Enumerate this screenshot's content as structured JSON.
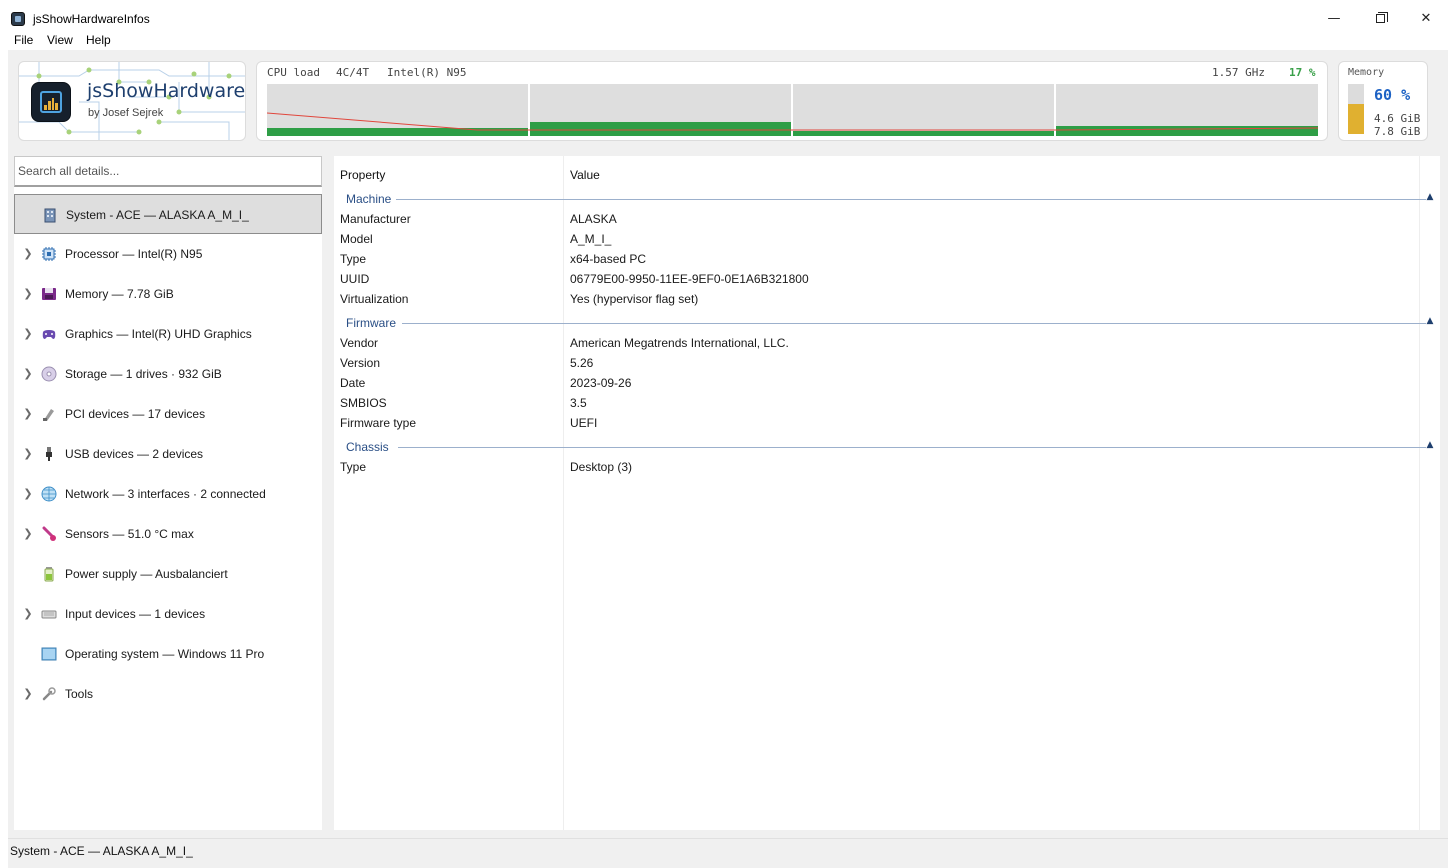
{
  "window": {
    "title": "jsShowHardwareInfos"
  },
  "menu": [
    "File",
    "View",
    "Help"
  ],
  "logo": {
    "title": "jsShowHardware",
    "subtitle": "by Josef Sejrek"
  },
  "cpu": {
    "label": "CPU load",
    "cores_label": "4C/4T",
    "model": "Intel(R) N95",
    "freq": "1.57 GHz",
    "load": "17 %",
    "core_loads": [
      0.15,
      0.27,
      0.1,
      0.2
    ]
  },
  "memory": {
    "label": "Memory",
    "percent": "60 %",
    "used": "4.6 GiB",
    "total": "7.8 GiB",
    "fraction": 0.6
  },
  "search": {
    "placeholder": "Search all details..."
  },
  "nav": [
    {
      "label": "System - ACE  —  ALASKA A_M_I_",
      "icon": "system-icon",
      "expandable": false,
      "selected": true
    },
    {
      "label": "Processor  —  Intel(R) N95",
      "icon": "processor-icon",
      "expandable": true
    },
    {
      "label": "Memory  —  7.78 GiB",
      "icon": "memory-icon",
      "expandable": true
    },
    {
      "label": "Graphics  —  Intel(R) UHD Graphics",
      "icon": "graphics-icon",
      "expandable": true
    },
    {
      "label": "Storage  —  1 drives · 932 GiB",
      "icon": "storage-icon",
      "expandable": true
    },
    {
      "label": "PCI devices  —  17 devices",
      "icon": "pci-icon",
      "expandable": true
    },
    {
      "label": "USB devices  —  2 devices",
      "icon": "usb-icon",
      "expandable": true
    },
    {
      "label": "Network  —  3 interfaces · 2 connected",
      "icon": "network-icon",
      "expandable": true
    },
    {
      "label": "Sensors  —  51.0 °C max",
      "icon": "sensors-icon",
      "expandable": true
    },
    {
      "label": "Power supply  —  Ausbalanciert",
      "icon": "power-supply-icon",
      "expandable": false
    },
    {
      "label": "Input devices  —  1 devices",
      "icon": "input-devices-icon",
      "expandable": true
    },
    {
      "label": "Operating system  —  Windows 11 Pro",
      "icon": "operating-system-icon",
      "expandable": false
    },
    {
      "label": "Tools",
      "icon": "tools-icon",
      "expandable": true
    }
  ],
  "table": {
    "col_property": "Property",
    "col_value": "Value",
    "groups": [
      {
        "name": "Machine",
        "rows": [
          [
            "Manufacturer",
            "ALASKA"
          ],
          [
            "Model",
            "A_M_I_"
          ],
          [
            "Type",
            "x64-based PC"
          ],
          [
            "UUID",
            "06779E00-9950-11EE-9EF0-0E1A6B321800"
          ],
          [
            "Virtualization",
            "Yes (hypervisor flag set)"
          ]
        ]
      },
      {
        "name": "Firmware",
        "rows": [
          [
            "Vendor",
            "American Megatrends International, LLC."
          ],
          [
            "Version",
            "5.26"
          ],
          [
            "Date",
            "2023-09-26"
          ],
          [
            "SMBIOS",
            "3.5"
          ],
          [
            "Firmware type",
            "UEFI"
          ]
        ]
      },
      {
        "name": "Chassis",
        "rows": [
          [
            "Type",
            "Desktop (3)"
          ]
        ]
      }
    ]
  },
  "status": {
    "text": "System - ACE  —  ALASKA A_M_I_"
  }
}
